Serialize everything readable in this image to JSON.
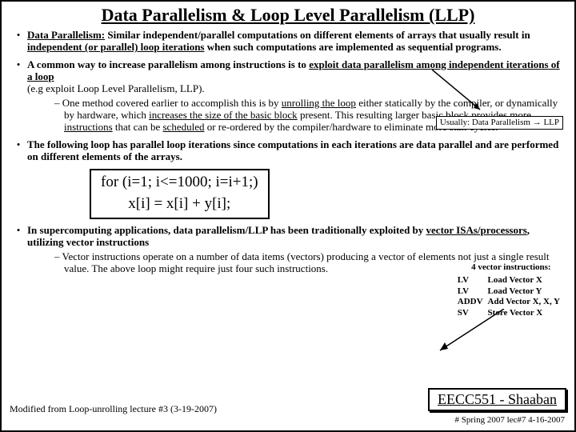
{
  "title": "Data Parallelism & Loop Level Parallelism (LLP)",
  "b1_lead": "Data Parallelism:",
  "b1_rest1": " Similar independent/parallel computations on different elements of arrays that usually result in ",
  "b1_under": "independent (or parallel) loop iterations",
  "b1_rest2": " when such computations are implemented as sequential programs.",
  "b2_lead": "A common way to increase parallelism among instructions is to ",
  "b2_under": "exploit data parallelism among independent iterations of a loop",
  "b2_tail": "(e.g exploit Loop Level Parallelism, LLP).",
  "callout_pre": "Usually:  Data Parallelism ",
  "callout_sym": "→",
  "callout_post": " LLP",
  "b2_sub_pre": "– One method covered earlier to accomplish this is by ",
  "b2_sub_u1": "unrolling the loop",
  "b2_sub_mid1": " either statically by the compiler, or dynamically by hardware, which ",
  "b2_sub_u2": "increases the size of the basic block",
  "b2_sub_mid2": " present. This resulting larger basic block provides ",
  "b2_sub_u3": "more instructions",
  "b2_sub_mid3": " that can be ",
  "b2_sub_u4": "scheduled",
  "b2_sub_end": " or re-ordered by the compiler/hardware to eliminate more stall cycles.",
  "b3": "The following loop has parallel loop iterations since computations in each iterations are data parallel and are performed on different elements of the arrays.",
  "code1": "for (i=1; i<=1000; i=i+1;)",
  "code2": "x[i] = x[i] + y[i];",
  "vec_hdr": "4 vector instructions:",
  "vec_rows": [
    {
      "op": "LV",
      "desc": "Load Vector X"
    },
    {
      "op": "LV",
      "desc": "Load Vector Y"
    },
    {
      "op": "ADDV",
      "desc": "Add Vector X, X, Y"
    },
    {
      "op": "SV",
      "desc": "Store Vector X"
    }
  ],
  "b4_pre": "In supercomputing applications, data parallelism/LLP has been traditionally exploited by ",
  "b4_u": "vector ISAs/processors",
  "b4_post": ", utilizing vector instructions",
  "b4_sub": "– Vector instructions operate on a number of data items (vectors) producing a vector of elements not just a single result value. The above loop might require just four such instructions.",
  "footer_left": "Modified from Loop-unrolling lecture #3 (3-19-2007)",
  "footer_box": "EECC551 - Shaaban",
  "footer_small": "#  Spring 2007 lec#7   4-16-2007"
}
